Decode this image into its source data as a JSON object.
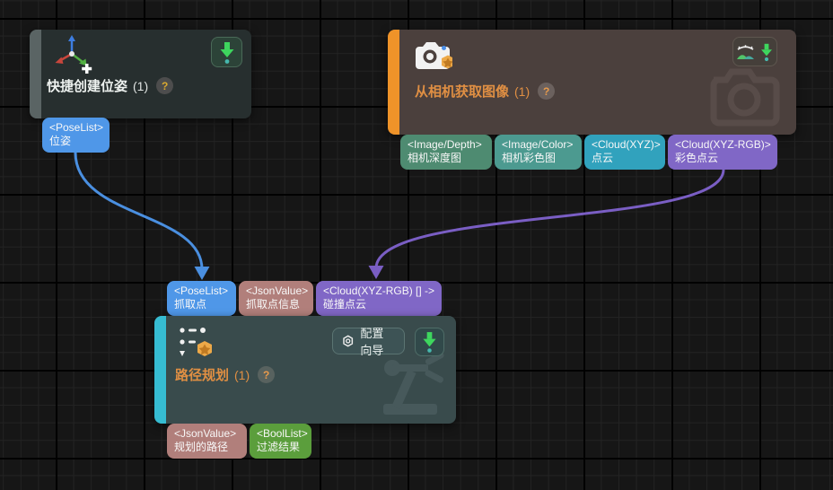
{
  "palette": {
    "canvas_bg": "#161616",
    "grid_minor": "#232323",
    "grid_major": "#000000",
    "port_blue": "#4f97e8",
    "port_rose": "#b17f7b",
    "port_purple": "#8067c6",
    "port_green_sea": "#4e8b71",
    "port_teal": "#4c9a90",
    "port_cyan": "#31a2bd",
    "port_green": "#5b9e3c",
    "wire_blue": "#4a8fe0",
    "wire_purple": "#7a5ec4",
    "accent_gray": "#5a6464",
    "accent_orange": "#ef9329",
    "accent_cyan": "#36bcd2",
    "title_orange": "#e08f43",
    "run_arrow_green": "#3ed65e",
    "status_dot_teal": "#46b8ae"
  },
  "icons": {
    "axis": "xyz-axis-icon",
    "camera": "camera-icon",
    "star_badge": "star-badge-icon",
    "run_arrow": "download-arrow-icon",
    "landscape": "image-preview-icon",
    "gear": "gear-icon",
    "dotted_path": "dotted-path-icon",
    "camera_watermark": "camera-outline-watermark",
    "robot_arm_watermark": "robot-arm-watermark"
  },
  "nodes": [
    {
      "title": "快捷创建位姿",
      "count": "(1)",
      "help": "?",
      "outputs": [
        {
          "type": "<PoseList>",
          "label": "位姿"
        }
      ]
    },
    {
      "title": "从相机获取图像",
      "count": "(1)",
      "help": "?",
      "outputs": [
        {
          "type": "<Image/Depth>",
          "label": "相机深度图"
        },
        {
          "type": "<Image/Color>",
          "label": "相机彩色图"
        },
        {
          "type": "<Cloud(XYZ)>",
          "label": "点云"
        },
        {
          "type": "<Cloud(XYZ-RGB)>",
          "label": "彩色点云"
        }
      ]
    },
    {
      "title": "路径规划",
      "count": "(1)",
      "help": "?",
      "wizard_button": "配置向导",
      "inputs": [
        {
          "type": "<PoseList>",
          "label": "抓取点"
        },
        {
          "type": "<JsonValue>",
          "label": "抓取点信息"
        },
        {
          "type": "<Cloud(XYZ-RGB) [] ->",
          "label": "碰撞点云"
        }
      ],
      "outputs": [
        {
          "type": "<JsonValue>",
          "label": "规划的路径"
        },
        {
          "type": "<BoolList>",
          "label": "过滤结果"
        }
      ]
    }
  ],
  "connections": [
    {
      "from": "快捷创建位姿 / 位姿",
      "to": "路径规划 / 抓取点",
      "color": "#4a8fe0"
    },
    {
      "from": "从相机获取图像 / 彩色点云",
      "to": "路径规划 / 碰撞点云",
      "color": "#7a5ec4"
    }
  ]
}
